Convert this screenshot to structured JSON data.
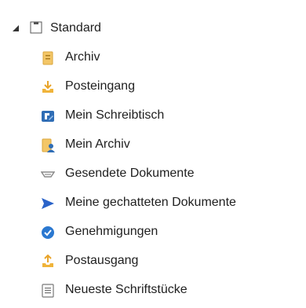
{
  "tree": {
    "root": {
      "label": "Standard",
      "expanded": true,
      "icon": "folder-outline-icon"
    },
    "items": [
      {
        "label": "Archiv",
        "icon": "archive-icon",
        "color": "#e8b85a"
      },
      {
        "label": "Posteingang",
        "icon": "inbox-download-icon",
        "color": "#e9a429"
      },
      {
        "label": "Mein Schreibtisch",
        "icon": "desk-icon",
        "color": "#2f6db5"
      },
      {
        "label": "Mein Archiv",
        "icon": "user-archive-icon",
        "color": "#e8b85a"
      },
      {
        "label": "Gesendete Dokumente",
        "icon": "sent-tray-icon",
        "color": "#8a8a8a"
      },
      {
        "label": "Meine gechatteten Dokumente",
        "icon": "send-arrow-icon",
        "color": "#2a63c9"
      },
      {
        "label": "Genehmigungen",
        "icon": "approval-check-icon",
        "color": "#2b78d0"
      },
      {
        "label": "Postausgang",
        "icon": "outbox-upload-icon",
        "color": "#e9a429"
      },
      {
        "label": "Neueste Schriftstücke",
        "icon": "recent-document-icon",
        "color": "#777777"
      }
    ]
  }
}
